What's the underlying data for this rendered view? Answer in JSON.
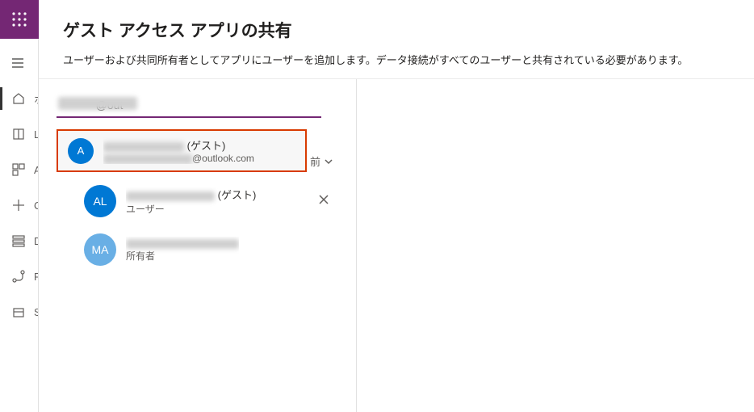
{
  "app": {
    "waffle_label": "app-launcher"
  },
  "header": {
    "title": "ゲスト アクセス アプリの共有",
    "subtitle": "ユーザーおよび共同所有者としてアプリにユーザーを追加します。データ接続がすべてのユーザーと共有されている必要があります。"
  },
  "sidebar": {
    "items": [
      {
        "icon": "home",
        "label": "ホ"
      },
      {
        "icon": "book",
        "label": "L"
      },
      {
        "icon": "apps",
        "label": "A"
      },
      {
        "icon": "plus",
        "label": "C"
      },
      {
        "icon": "data",
        "label": "D"
      },
      {
        "icon": "flow",
        "label": "F"
      },
      {
        "icon": "solutions",
        "label": "S"
      }
    ]
  },
  "share": {
    "search_value": "            @out",
    "suggestion": {
      "avatar_initial": "A",
      "display_suffix": " (ゲスト)",
      "email_suffix": "@outlook.com"
    },
    "sort_label": "前",
    "people": [
      {
        "avatar_initial": "AL",
        "avatar_color": "blue",
        "name_suffix": " (ゲスト)",
        "role": "ユーザー",
        "removable": true
      },
      {
        "avatar_initial": "MA",
        "avatar_color": "lightblue",
        "name_suffix": "",
        "role": "所有者",
        "removable": false
      }
    ]
  }
}
